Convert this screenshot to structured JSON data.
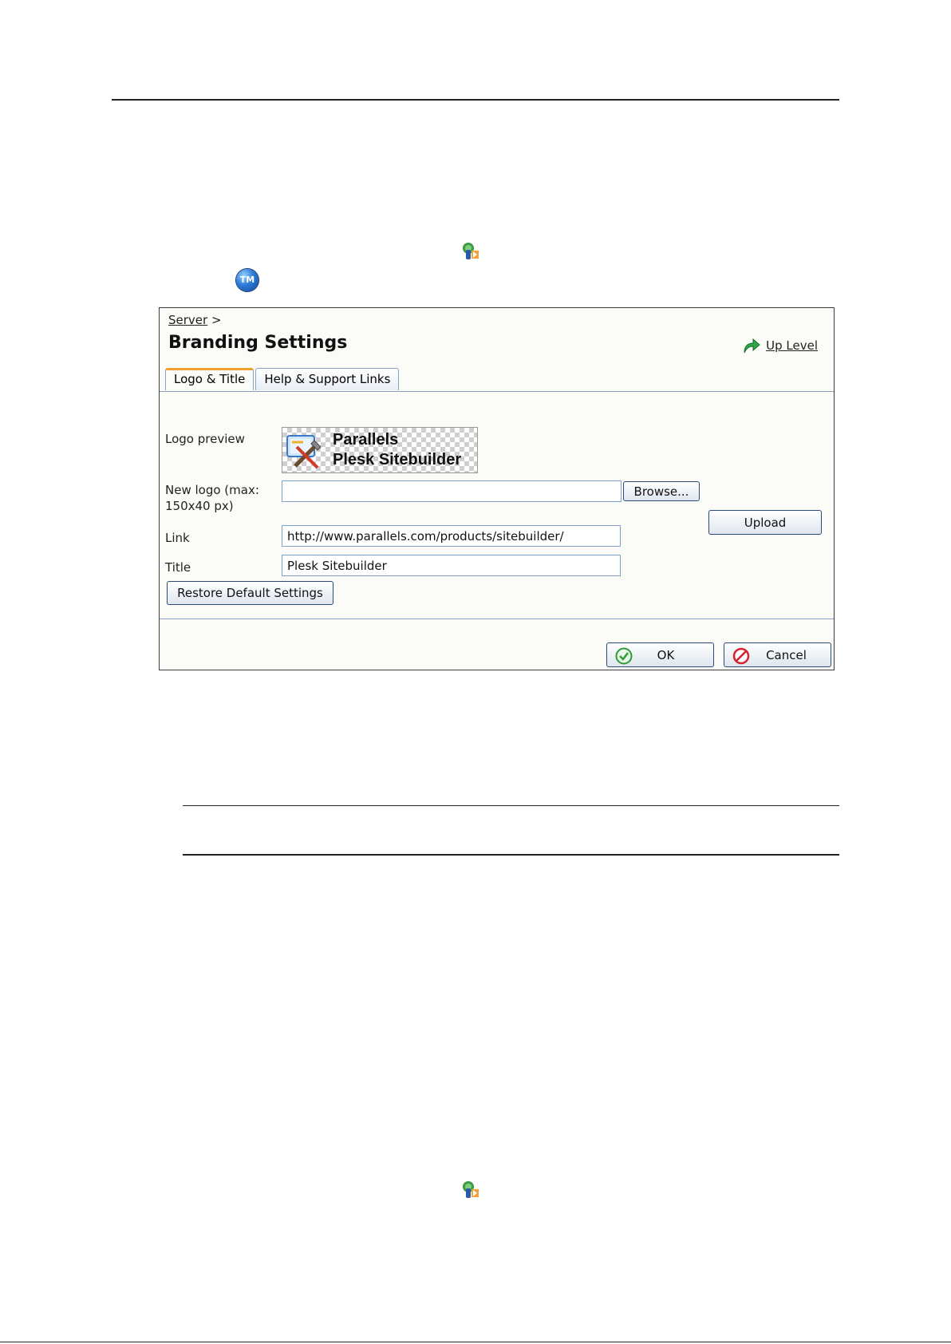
{
  "dialog": {
    "breadcrumb": "Server",
    "breadcrumb_sep": ">",
    "title": "Branding Settings",
    "up_level": "Up Level",
    "tabs": [
      {
        "label": "Logo & Title",
        "active": true
      },
      {
        "label": "Help & Support Links",
        "active": false
      }
    ],
    "form": {
      "logo_preview_label": "Logo preview",
      "logo_preview_text_1": "Parallels",
      "logo_preview_text_2": "Plesk Sitebuilder",
      "new_logo_label_1": "New logo (max:",
      "new_logo_label_2": "150x40 px)",
      "new_logo_value": "",
      "browse_button": "Browse...",
      "upload_button": "Upload",
      "link_label": "Link",
      "link_value": "http://www.parallels.com/products/sitebuilder/",
      "title_label": "Title",
      "title_value": "Plesk Sitebuilder",
      "restore_button": "Restore Default Settings"
    },
    "ok_button": "OK",
    "cancel_button": "Cancel"
  },
  "icons": {
    "gear_icon": "server-settings-icon",
    "tm_icon": "tm-icon",
    "tm_label": "TM"
  },
  "colors": {
    "tab_active_accent": "#f0a030",
    "field_border": "#7fa0c8",
    "button_border": "#2b4a74"
  }
}
